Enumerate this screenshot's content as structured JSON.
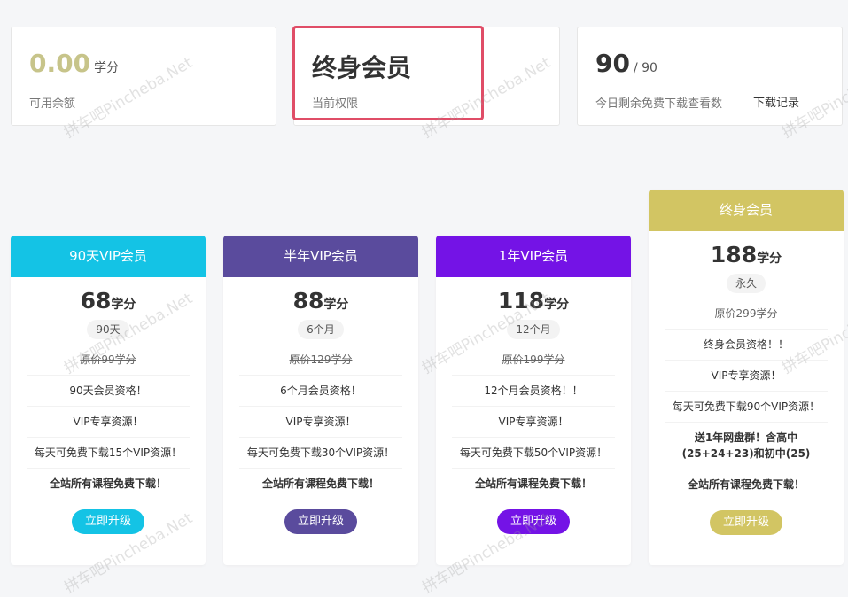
{
  "stats": {
    "balance": {
      "value": "0.00",
      "unit": "学分",
      "caption": "可用余额"
    },
    "membership": {
      "value": "终身会员",
      "caption": "当前权限"
    },
    "downloads": {
      "value": "90",
      "total": "/ 90",
      "caption": "今日剩余免费下载查看数",
      "link": "下载记录"
    }
  },
  "colors": {
    "cyan": "#14c3e5",
    "indigo": "#5a4b9d",
    "purple": "#7413e6",
    "gold": "#d2c563",
    "balance_gold": "#c7c48a",
    "highlight": "#e04d67"
  },
  "plans": [
    {
      "title": "90天VIP会员",
      "price": "68",
      "unit": "学分",
      "duration": "90天",
      "original": "原价99学分",
      "features": [
        "90天会员资格！",
        "VIP专享资源！",
        "每天可免费下载15个VIP资源！"
      ],
      "highlight": "全站所有课程免费下载！",
      "button": "立即升级"
    },
    {
      "title": "半年VIP会员",
      "price": "88",
      "unit": "学分",
      "duration": "6个月",
      "original": "原价129学分",
      "features": [
        "6个月会员资格！",
        "VIP专享资源！",
        "每天可免费下载30个VIP资源！"
      ],
      "highlight": "全站所有课程免费下载！",
      "button": "立即升级"
    },
    {
      "title": "1年VIP会员",
      "price": "118",
      "unit": "学分",
      "duration": "12个月",
      "original": "原价199学分",
      "features": [
        "12个月会员资格！！",
        "VIP专享资源！",
        "每天可免费下载50个VIP资源！"
      ],
      "highlight": "全站所有课程免费下载！",
      "button": "立即升级"
    },
    {
      "title": "终身会员",
      "price": "188",
      "unit": "学分",
      "duration": "永久",
      "original": "原价299学分",
      "features": [
        "终身会员资格！！",
        "VIP专享资源！",
        "每天可免费下载90个VIP资源！"
      ],
      "extra": "送1年网盘群！含高中(25+24+23)和初中(25)",
      "highlight": "全站所有课程免费下载！",
      "button": "立即升级"
    }
  ],
  "watermark": "拼车吧Pincheba.Net"
}
